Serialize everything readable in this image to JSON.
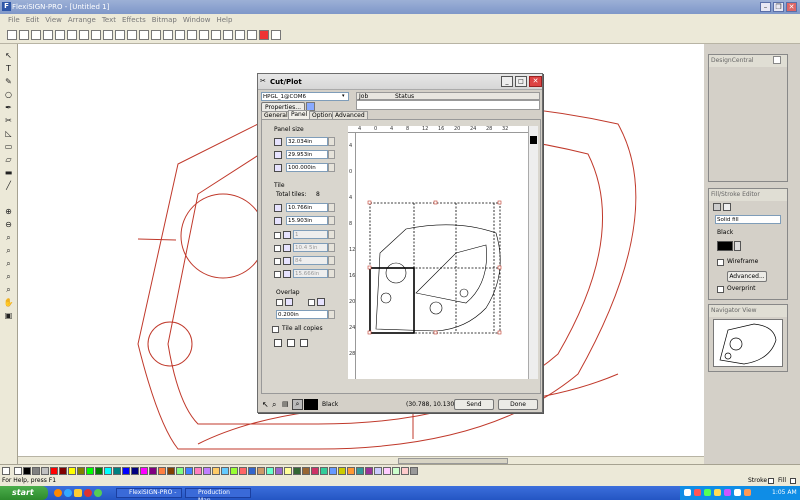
{
  "app": {
    "title": "FlexiSIGN-PRO - [Untitled 1]",
    "menus": [
      "File",
      "Edit",
      "View",
      "Arrange",
      "Text",
      "Effects",
      "Bitmap",
      "Window",
      "Help"
    ]
  },
  "dialog": {
    "title": "Cut/Plot",
    "device": "HPGL_1@COM6",
    "properties_label": "Properties...",
    "job_header": "Job",
    "status_header": "Status",
    "tabs": [
      "General",
      "Panel",
      "Options",
      "Advanced"
    ],
    "active_tab": "Panel",
    "panel_size_label": "Panel size",
    "panel_width": "32.034in",
    "panel_height": "29.953in",
    "panel_overlap": "100.000in",
    "tile_label": "Tile",
    "total_tiles_label": "Total tiles:",
    "total_tiles": "8",
    "tile_width": "10.766in",
    "tile_height": "15.903in",
    "disabled_fields": [
      "1",
      "10.4 5in",
      "84",
      "15.666in"
    ],
    "overlap_label": "Overlap",
    "overlap_value": "0.200in",
    "tile_all_copies_label": "Tile all copies",
    "ruler_top": [
      "4",
      "0",
      "4",
      "8",
      "12",
      "16",
      "20",
      "24",
      "28",
      "32"
    ],
    "ruler_left": [
      "4",
      "0",
      "4",
      "8",
      "12",
      "16",
      "20",
      "24",
      "28"
    ],
    "color_label": "Black",
    "coords": "(30.788, 10.130)",
    "send_label": "Send",
    "done_label": "Done"
  },
  "panels": {
    "design_central": "DesignCentral",
    "fill_stroke": {
      "title": "Fill/Stroke Editor",
      "fill_type": "Solid fill",
      "color_name": "Black",
      "wireframe_label": "Wireframe",
      "advanced_label": "Advanced...",
      "overprint_label": "Overprint"
    },
    "navigator": "Navigator View"
  },
  "status": {
    "help_text": "For Help, press F1",
    "stroke_label": "Stroke",
    "fill_label": "Fill"
  },
  "taskbar": {
    "start_label": "start",
    "tasks": [
      "FlexiSIGN-PRO - ...",
      "Production Man..."
    ],
    "clock": "1:05 AM"
  },
  "colors": {
    "accent": "#2455c3",
    "outline_red": "#c0392b",
    "palette": [
      "#ffffff",
      "#000000",
      "#808080",
      "#c0c0c0",
      "#ff0000",
      "#800000",
      "#ffff00",
      "#808000",
      "#00ff00",
      "#008000",
      "#00ffff",
      "#008080",
      "#0000ff",
      "#000080",
      "#ff00ff",
      "#800080",
      "#ff8040",
      "#804000",
      "#80ff80",
      "#4080ff",
      "#ff80c0",
      "#c080ff",
      "#ffcc66",
      "#66ccff",
      "#99ff33",
      "#ff6666",
      "#3366cc",
      "#cc9966",
      "#66ffcc",
      "#9966cc",
      "#ffff99",
      "#336633",
      "#996633",
      "#cc3366",
      "#33cc99",
      "#6699ff",
      "#cccc00",
      "#ff9933",
      "#339999",
      "#993399",
      "#ccccff",
      "#ffccff",
      "#ccffcc",
      "#ffcccc",
      "#999999"
    ]
  }
}
